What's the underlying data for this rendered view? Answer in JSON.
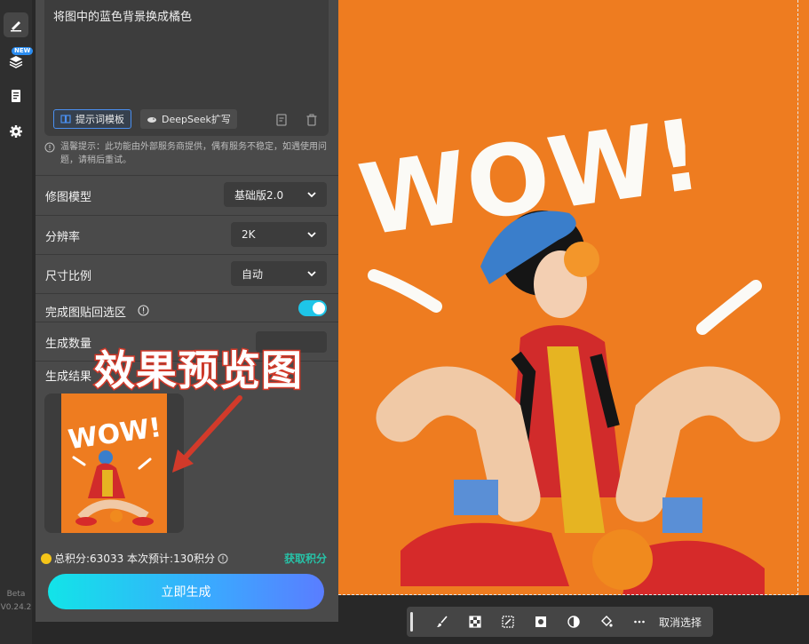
{
  "rail": {
    "items": [
      "edit",
      "layers",
      "notes",
      "settings"
    ],
    "new_badge": "NEW",
    "beta_label": "Beta",
    "version": "V0.24.2"
  },
  "prompt": {
    "text": "将图中的蓝色背景换成橘色",
    "template_chip": "提示词模板",
    "deepseek_chip": "DeepSeek扩写"
  },
  "tip": {
    "text": "温馨提示：此功能由外部服务商提供，偶有服务不稳定，如遇使用问题，请稍后重试。"
  },
  "settings": {
    "model_label": "修图模型",
    "model_value": "基础版2.0",
    "resolution_label": "分辨率",
    "resolution_value": "2K",
    "ratio_label": "尺寸比例",
    "ratio_value": "自动",
    "paste_back_label": "完成图贴回选区",
    "paste_back_enabled": true,
    "quantity_label": "生成数量",
    "result_label": "生成结果"
  },
  "annotation": {
    "text": "效果预览图"
  },
  "footer": {
    "credits_text": "总积分:63033  本次预计:130积分",
    "earn_link": "获取积分",
    "generate_button": "立即生成"
  },
  "canvas": {
    "wow_text": "WOW!"
  },
  "toolbar": {
    "cancel_label": "取消选择"
  },
  "colors": {
    "accent_cyan": "#1ec5e8",
    "canvas_orange": "#ee7c20",
    "earn_green": "#27c3a8",
    "annotation_red": "#d23a2a"
  }
}
